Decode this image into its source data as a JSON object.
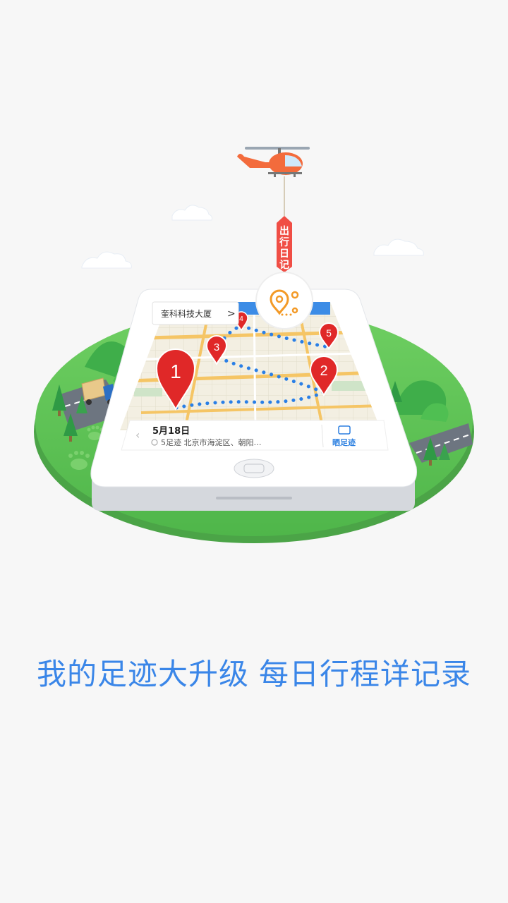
{
  "headline": {
    "part1": "我的足迹大升级",
    "part2": "每日行程详记录"
  },
  "banner_tag": {
    "text": "出行日记"
  },
  "location_bubble": {
    "label": "奎科科技大厦",
    "chevron": ">"
  },
  "day_card": {
    "date": "5月18日",
    "summary": "5足迹  北京市海淀区、朝阳…",
    "action_label": "晒足迹",
    "prev_arrow": "‹"
  },
  "pins": [
    {
      "number": "1"
    },
    {
      "number": "2"
    },
    {
      "number": "3"
    },
    {
      "number": "4"
    },
    {
      "number": "5"
    }
  ],
  "colors": {
    "background": "#f7f7f7",
    "headline": "#3a86e8",
    "island_green": "#5fc45a",
    "pin_red": "#e02828",
    "route_blue": "#2a7fe6",
    "helicopter_orange": "#f36b3c",
    "tag_red": "#f04e45"
  },
  "icons": [
    "helicopter-icon",
    "cloud-icon",
    "map-pin-icon",
    "footprint-icon",
    "tree-icon",
    "truck-icon",
    "share-icon",
    "location-route-icon"
  ]
}
